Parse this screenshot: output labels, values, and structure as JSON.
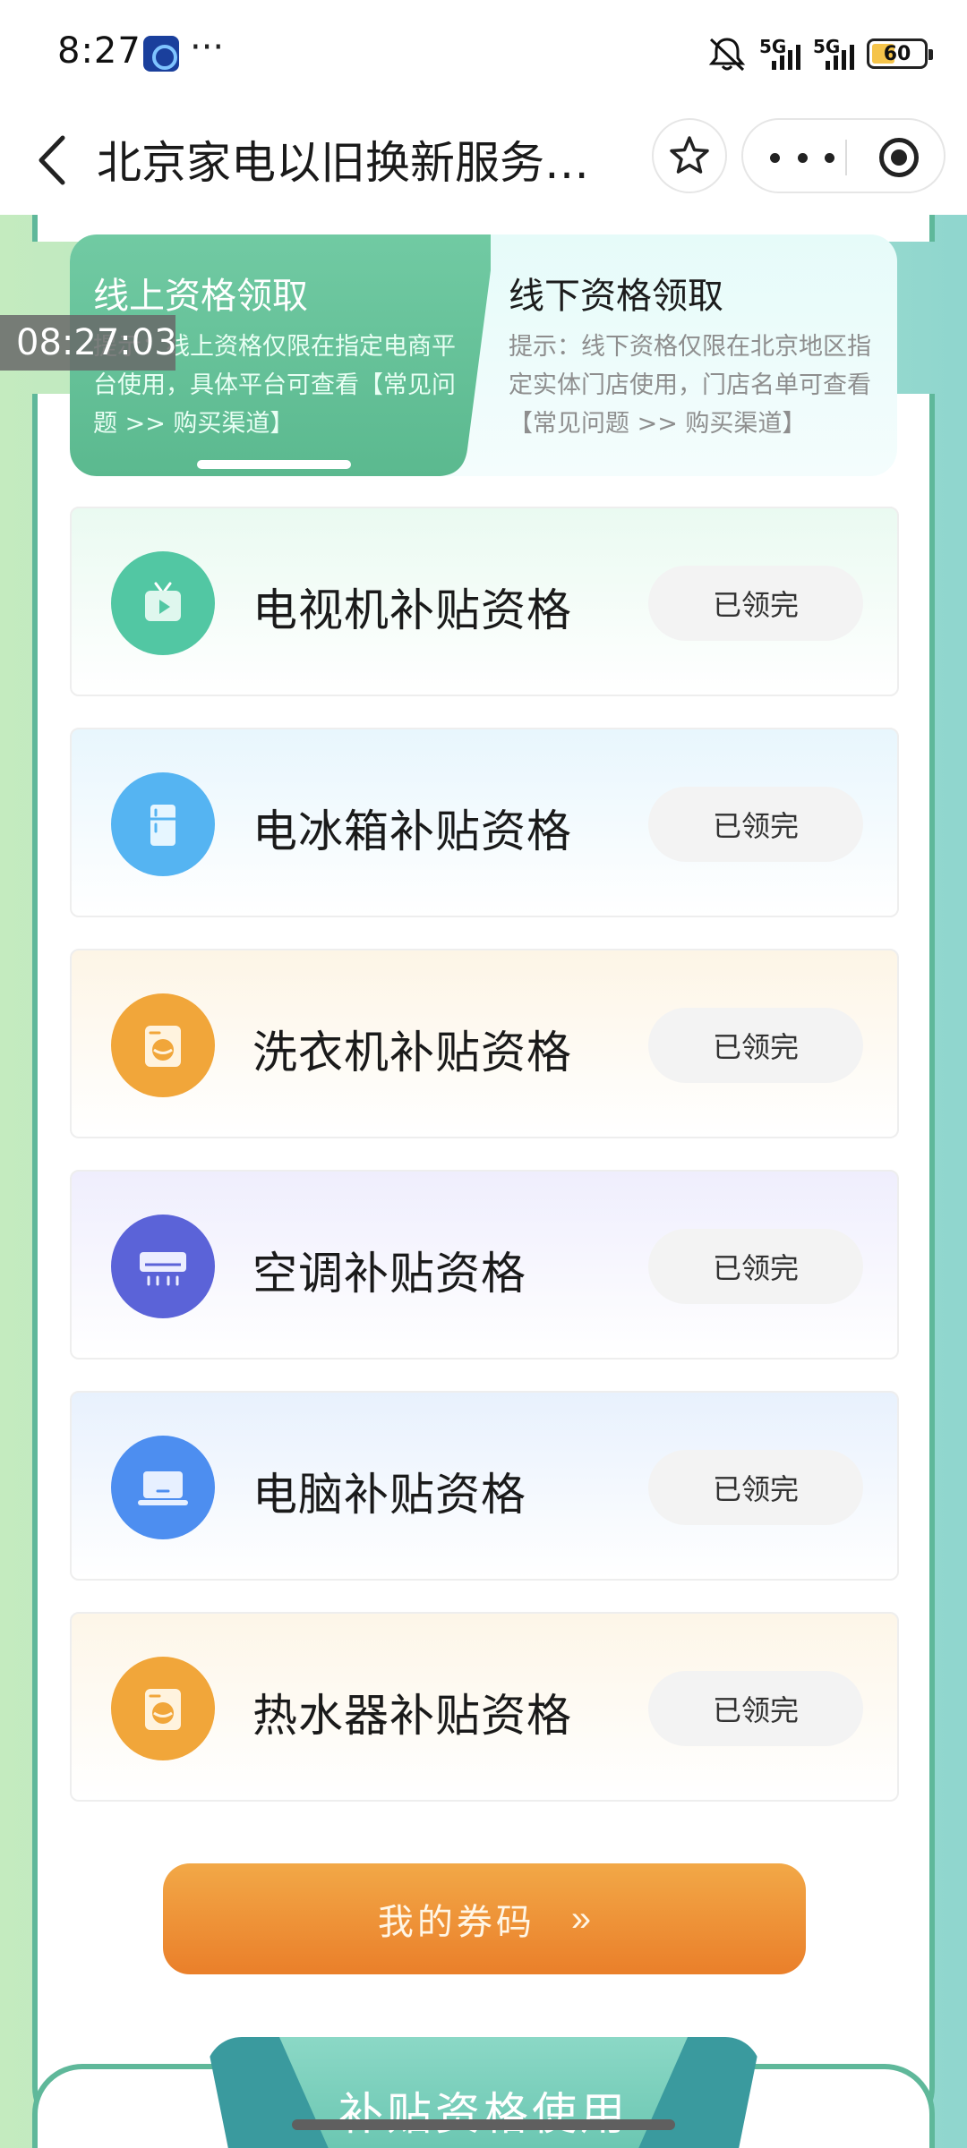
{
  "status_bar": {
    "time": "8:27",
    "more": "···",
    "net1": "5G",
    "net2": "5G",
    "battery": "60"
  },
  "nav": {
    "title": "北京家电以旧换新服务…"
  },
  "overlay_time": "08:27:03",
  "tabs": {
    "online": {
      "title": "线上资格领取",
      "hint": "提示：线上资格仅限在指定电商平台使用，具体平台可查看【常见问题 >> 购买渠道】"
    },
    "offline": {
      "title": "线下资格领取",
      "hint": "提示：线下资格仅限在北京地区指定实体门店使用，门店名单可查看【常见问题 >> 购买渠道】"
    }
  },
  "subsidies": [
    {
      "name": "电视机补贴资格",
      "status": "已领完",
      "icon": "tv-icon",
      "color": "#52c7a3",
      "bg": "#eafaf1"
    },
    {
      "name": "电冰箱补贴资格",
      "status": "已领完",
      "icon": "fridge-icon",
      "color": "#55b4f2",
      "bg": "#e8f6fd"
    },
    {
      "name": "洗衣机补贴资格",
      "status": "已领完",
      "icon": "washer-icon",
      "color": "#f1a63a",
      "bg": "#fdf5e6"
    },
    {
      "name": "空调补贴资格",
      "status": "已领完",
      "icon": "air-conditioner-icon",
      "color": "#5b63d8",
      "bg": "#efeefd"
    },
    {
      "name": "电脑补贴资格",
      "status": "已领完",
      "icon": "laptop-icon",
      "color": "#4d8ef0",
      "bg": "#e8f1fd"
    },
    {
      "name": "热水器补贴资格",
      "status": "已领完",
      "icon": "water-heater-icon",
      "color": "#f1a63a",
      "bg": "#fdf6e8"
    }
  ],
  "coupon_button": {
    "label": "我的券码",
    "chevron": "»"
  },
  "bottom_section": {
    "title": "补贴资格使用"
  }
}
